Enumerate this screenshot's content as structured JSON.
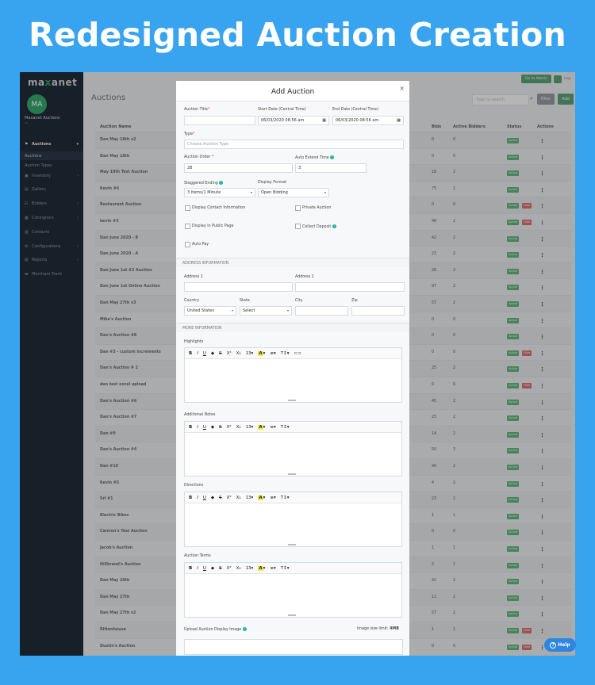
{
  "banner": {
    "title": "Redesigned Auction Creation"
  },
  "app": {
    "logo_prefix": "ma",
    "logo_x": "x",
    "logo_suffix": "anet",
    "avatar_initials": "MA",
    "account_name": "Maxanet Auctions",
    "account_sub": "~",
    "topbar": {
      "go_admin": "Go to Admin",
      "login": "Log"
    }
  },
  "sidebar": {
    "items": [
      {
        "label": "Auctions",
        "icon": "gavel-icon",
        "glyph": "⚑",
        "active": true,
        "chevron": "▾"
      },
      {
        "label": "Auctions",
        "sub": true,
        "selected": true
      },
      {
        "label": "Auction Types",
        "sub": true
      },
      {
        "label": "Inventory",
        "icon": "box-icon",
        "glyph": "▣",
        "chevron": "›"
      },
      {
        "label": "Gallery",
        "icon": "image-icon",
        "glyph": "▤",
        "chevron": ""
      },
      {
        "label": "Bidders",
        "icon": "users-icon",
        "glyph": "☷",
        "chevron": "›"
      },
      {
        "label": "Consignors",
        "icon": "calendar-icon",
        "glyph": "▦",
        "chevron": "›"
      },
      {
        "label": "Contacts",
        "icon": "contacts-icon",
        "glyph": "▥",
        "chevron": ""
      },
      {
        "label": "Configurations",
        "icon": "settings-icon",
        "glyph": "⚙",
        "chevron": "›"
      },
      {
        "label": "Reports",
        "icon": "report-icon",
        "glyph": "▧",
        "chevron": "›"
      },
      {
        "label": "Merchant Track",
        "icon": "merchant-icon",
        "glyph": "▬",
        "chevron": ""
      }
    ]
  },
  "page": {
    "title": "Auctions",
    "search_placeholder": "Type to search",
    "filter_label": "Filter",
    "add_label": "Add"
  },
  "table": {
    "headers": {
      "name": "Auction Name",
      "bids": "Bids",
      "active_bidders": "Active Bidders",
      "status": "Status",
      "actions": "Actions"
    },
    "status_active": "Active",
    "status_hide": "Hide",
    "action_glyph": "⋮",
    "rows": [
      {
        "name": "Dan May 18th v2",
        "bids": "0",
        "bidders": "0",
        "hide": false
      },
      {
        "name": "Dan May 18th",
        "bids": "0",
        "bidders": "0",
        "hide": false
      },
      {
        "name": "May 19th Test Auction",
        "bids": "18",
        "bidders": "2",
        "hide": false
      },
      {
        "name": "Kevin #4",
        "bids": "75",
        "bidders": "2",
        "hide": false
      },
      {
        "name": "Restaurant Auction",
        "bids": "0",
        "bidders": "0",
        "hide": true
      },
      {
        "name": "kevin #3",
        "bids": "48",
        "bidders": "2",
        "hide": true
      },
      {
        "name": "Dan June 2020 - B",
        "bids": "42",
        "bidders": "2",
        "hide": false
      },
      {
        "name": "Dan June 2020 - A",
        "bids": "23",
        "bidders": "2",
        "hide": false
      },
      {
        "name": "Dan June 1st #2 Auction",
        "bids": "26",
        "bidders": "2",
        "hide": false
      },
      {
        "name": "Dan June 1st Online Auction",
        "bids": "97",
        "bidders": "2",
        "hide": false
      },
      {
        "name": "Dan May 27th v3",
        "bids": "57",
        "bidders": "2",
        "hide": false
      },
      {
        "name": "Mike's Auction",
        "bids": "0",
        "bidders": "0",
        "hide": false
      },
      {
        "name": "Dan's Auction #8",
        "bids": "0",
        "bidders": "0",
        "hide": false
      },
      {
        "name": "Dan #3 - custom increments",
        "bids": "0",
        "bidders": "0",
        "hide": true
      },
      {
        "name": "Dan's Auction # 2",
        "bids": "25",
        "bidders": "2",
        "hide": false
      },
      {
        "name": "dan test excel upload",
        "bids": "0",
        "bidders": "0",
        "hide": true
      },
      {
        "name": "Dan's Auction #6",
        "bids": "45",
        "bidders": "2",
        "hide": false
      },
      {
        "name": "Dan's Auction #7",
        "bids": "25",
        "bidders": "2",
        "hide": false
      },
      {
        "name": "Dan #9",
        "bids": "14",
        "bidders": "2",
        "hide": false
      },
      {
        "name": "Dan's Auction #4",
        "bids": "50",
        "bidders": "3",
        "hide": false
      },
      {
        "name": "Dan #10",
        "bids": "46",
        "bidders": "2",
        "hide": false
      },
      {
        "name": "Kevin #5",
        "bids": "4",
        "bidders": "2",
        "hide": false
      },
      {
        "name": "Sri #1",
        "bids": "23",
        "bidders": "2",
        "hide": false
      },
      {
        "name": "Electric Bikes",
        "bids": "1",
        "bidders": "1",
        "hide": false
      },
      {
        "name": "Cannon's Test Auction",
        "bids": "0",
        "bidders": "0",
        "hide": false
      },
      {
        "name": "Jacob's Auction",
        "bids": "1",
        "bidders": "1",
        "hide": false
      },
      {
        "name": "Hillbrand's Auction",
        "bids": "2",
        "bidders": "1",
        "hide": false
      },
      {
        "name": "Dan May 20th",
        "bids": "42",
        "bidders": "2",
        "hide": false
      },
      {
        "name": "Dan May 27th",
        "bids": "11",
        "bidders": "2",
        "hide": false
      },
      {
        "name": "Dan May 27th v2",
        "bids": "57",
        "bidders": "2",
        "hide": false
      },
      {
        "name": "Rittenhouse",
        "bids": "1",
        "bidders": "1",
        "hide": true
      },
      {
        "name": "Dustin's Auction",
        "bids": "0",
        "bidders": "0",
        "hide": true
      }
    ]
  },
  "modal": {
    "title": "Add Auction",
    "close": "×",
    "auction_title_label": "Auction Title",
    "start_date_label": "Start Date (Central Time)",
    "start_date_value": "06/03/2020 08:56 am",
    "end_date_label": "End Date (Central Time)",
    "end_date_value": "06/03/2020 08:56 am",
    "type_label": "Type",
    "type_placeholder": "Choose Auction Type",
    "auction_order_label": "Auction Order",
    "auction_order_value": "28",
    "auto_extend_label": "Auto Extend Time",
    "auto_extend_value": "3",
    "staggered_label": "Staggered Ending",
    "staggered_value": "3 Items/1 Minute",
    "display_format_label": "Display Format",
    "display_format_value": "Open Bidding",
    "chk_contact": "Display Contact Information",
    "chk_private": "Private Auction",
    "chk_public": "Display in Public Page",
    "chk_collect": "Collect Deposit",
    "chk_autopay": "Auto Pay",
    "address_section": "ADDRESS INFORMATION",
    "address1_label": "Address 1",
    "address2_label": "Address 2",
    "country_label": "Country",
    "country_value": "United States",
    "state_label": "State",
    "state_value": "Select",
    "city_label": "City",
    "zip_label": "Zip",
    "more_section": "MORE INFORMATION",
    "highlights_label": "Highlights",
    "notes_label": "Additional Notes",
    "directions_label": "Directions",
    "terms_label": "Auction Terms",
    "upload_label": "Upload Auction Display Image",
    "image_limit_prefix": "Image size limit:",
    "image_limit_value": "4MB",
    "toolbar": {
      "bold": "B",
      "italic": "I",
      "underline": "U",
      "eraser": "◆",
      "strike": "S",
      "sup": "X²",
      "sub": "X₂",
      "size": "13▾",
      "color": "A",
      "color_caret": "▾",
      "align": "≡▾",
      "textsize": "T↕▾",
      "link": "⊂⊃"
    }
  },
  "help": {
    "label": "Help",
    "icon": "?"
  }
}
